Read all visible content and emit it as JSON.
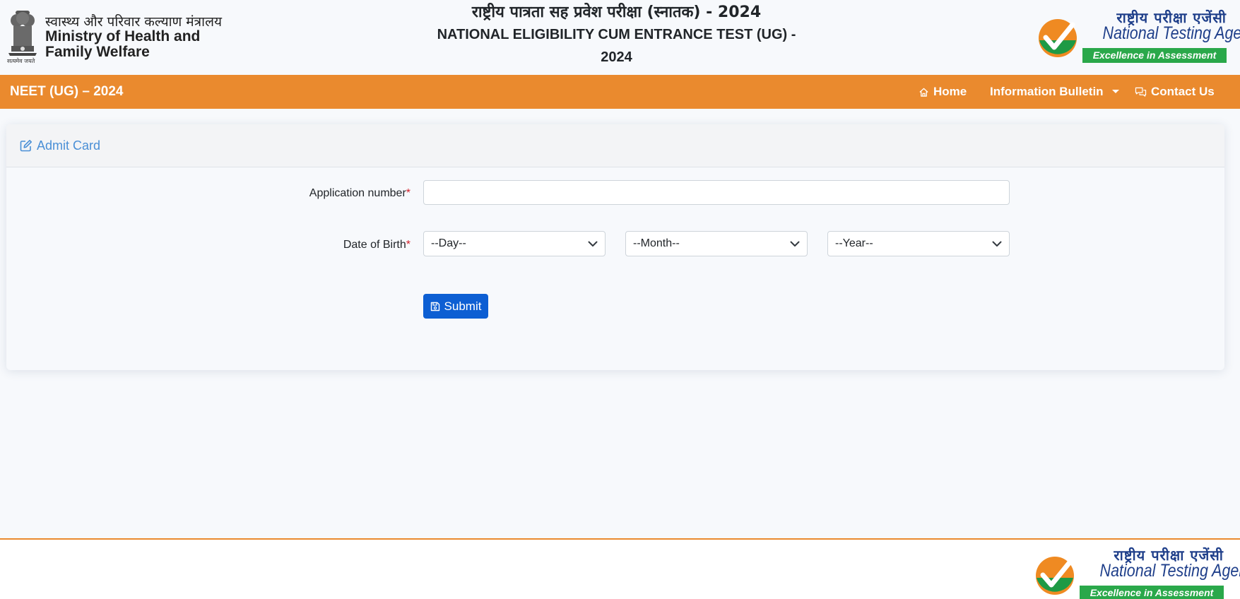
{
  "header": {
    "ministry": {
      "hindi": "स्वास्थ्य और परिवार कल्याण मंत्रालय",
      "english_line1": "Ministry of Health and",
      "english_line2": "Family Welfare",
      "emblem_motto": "सत्यमेव जयते",
      "emblem_icon": "national-emblem-icon"
    },
    "exam_title": {
      "hindi": "राष्ट्रीय पात्रता सह प्रवेश परीक्षा (स्नातक) - 2024",
      "english_line1": "NATIONAL ELIGIBILITY CUM ENTRANCE TEST (UG) -",
      "english_line2": "2024"
    },
    "agency_logo": {
      "hindi": "राष्ट्रीय परीक्षा एजेंसी",
      "english": "National Testing Agency",
      "tagline": "Excellence in Assessment"
    }
  },
  "navbar": {
    "brand": "NEET (UG) – 2024",
    "items": [
      {
        "label": "Home",
        "icon": "home-icon"
      },
      {
        "label": "Information Bulletin",
        "icon": "caret-down-icon"
      },
      {
        "label": "Contact Us",
        "icon": "chat-icon"
      }
    ]
  },
  "card": {
    "title": "Admit Card",
    "title_icon": "edit-icon",
    "fields": {
      "application_number": {
        "label": "Application number",
        "required_mark": "*",
        "value": ""
      },
      "dob": {
        "label": "Date of Birth",
        "required_mark": "*",
        "day": "--Day--",
        "month": "--Month--",
        "year": "--Year--"
      }
    },
    "submit_label": "Submit",
    "submit_icon": "save-icon"
  },
  "footer": {
    "agency_logo": {
      "hindi": "राष्ट्रीय परीक्षा एजेंसी",
      "english": "National Testing Agency",
      "tagline": "Excellence in Assessment"
    }
  },
  "colors": {
    "navbar": "#ea8a2e",
    "submit_button": "#0d5fd3",
    "card_title": "#4a8fd6",
    "required": "#d21f2a",
    "agency_blue": "#1f3f8a",
    "agency_green": "#2aa84a"
  }
}
